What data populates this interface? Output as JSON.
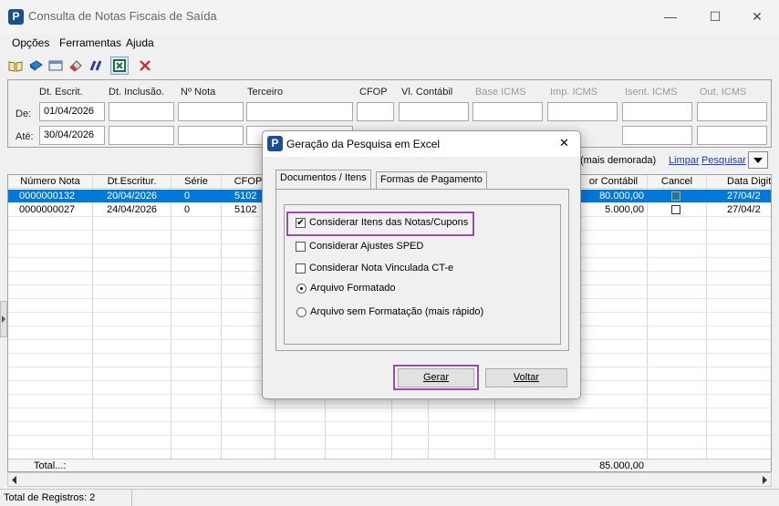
{
  "window": {
    "title": "Consulta de Notas Fiscais de Saída",
    "app_icon_letter": "P",
    "minimize": "—",
    "maximize": "☐",
    "close": "✕"
  },
  "menu": [
    "Opções",
    "Ferramentas",
    "Ajuda"
  ],
  "toolbar": {
    "icons": [
      "open-book-icon",
      "blue-book-icon",
      "window-icon",
      "eraser-icon",
      "tools-icon",
      "excel-icon",
      "close-x-icon"
    ]
  },
  "filters": {
    "columns": [
      "Dt. Escrit.",
      "Dt. Inclusão.",
      "Nº Nota",
      "Terceiro",
      "CFOP",
      "Vl. Contábil",
      "Base ICMS",
      "Imp. ICMS",
      "Isent. ICMS",
      "Out. ICMS"
    ],
    "row_labels": [
      "De:",
      "Até:"
    ],
    "de_date": "01/04/2026",
    "ate_date": "30/04/2026",
    "hint": "(mais demorada)",
    "limpar": "Limpar",
    "pesquisar": "Pesquisar"
  },
  "grid": {
    "headers": [
      "Número Nota",
      "Dt.Escritur.",
      "Série",
      "CFOP",
      "or Contábil",
      "Cancel",
      "Data Digita"
    ],
    "rows": [
      {
        "numero": "0000000132",
        "dt": "20/04/2026",
        "serie": "0",
        "cfop": "5102",
        "valor": "80.000,00",
        "data": "27/04/2"
      },
      {
        "numero": "0000000027",
        "dt": "24/04/2026",
        "serie": "0",
        "cfop": "5102",
        "valor": "5.000,00",
        "data": "27/04/2"
      }
    ],
    "total_label": "Total...:",
    "total_value": "85.000,00"
  },
  "status": {
    "text": "Total de Registros: 2"
  },
  "dialog": {
    "title": "Geração da Pesquisa em Excel",
    "close": "✕",
    "tabs": [
      "Documentos / Itens",
      "Formas de Pagamento"
    ],
    "options": {
      "itens": "Considerar Itens das Notas/Cupons",
      "sped": "Considerar Ajustes SPED",
      "cte": "Considerar Nota Vinculada CT-e",
      "formatado": "Arquivo Formatado",
      "sem_formatacao": "Arquivo sem Formatação (mais rápido)"
    },
    "gerar": "Gerar",
    "voltar": "Voltar"
  },
  "colors": {
    "selection": "#0078d7",
    "highlight": "#9b4ea8",
    "link": "#1a3fbf"
  }
}
